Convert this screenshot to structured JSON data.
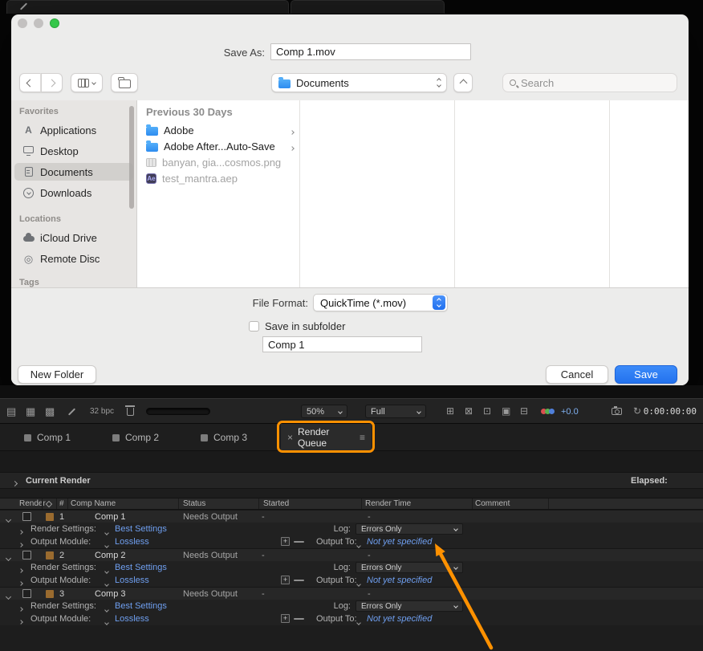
{
  "colors": {
    "accent_orange": "#ff9100",
    "link_blue": "#6f9ff0",
    "save_blue": "#2d7ff0"
  },
  "icons": {
    "applications_glyph": "A",
    "ae_badge": "Ae",
    "tab_close": "×",
    "tab_menu": "≡",
    "add": "+",
    "refresh": "↻",
    "flowchart": "▤",
    "snapshot_grid": "▦",
    "transparency_grid": "▩",
    "choose_grid": "⊞",
    "mask_toggle": "⊠",
    "region_of_interest": "⊡",
    "guides": "▣",
    "rulers": "⊟",
    "remote_disc": "◎"
  },
  "dialog": {
    "save_as_label": "Save As:",
    "filename": "Comp 1.mov",
    "toolbar": {
      "location": "Documents",
      "search_placeholder": "Search"
    },
    "sidebar": {
      "sections": [
        {
          "header": "Favorites",
          "items": [
            {
              "label": "Applications"
            },
            {
              "label": "Desktop"
            },
            {
              "label": "Documents",
              "selected": true
            },
            {
              "label": "Downloads"
            }
          ]
        },
        {
          "header": "Locations",
          "items": [
            {
              "label": "iCloud Drive"
            },
            {
              "label": "Remote Disc"
            }
          ]
        },
        {
          "header": "Tags",
          "items": []
        }
      ]
    },
    "browser": {
      "group_header": "Previous 30 Days",
      "items": [
        {
          "label": "Adobe",
          "type": "folder"
        },
        {
          "label": "Adobe After...Auto-Save",
          "type": "folder"
        },
        {
          "label": "banyan, gia...cosmos.png",
          "type": "image"
        },
        {
          "label": "test_mantra.aep",
          "type": "project"
        }
      ]
    },
    "format": {
      "label": "File Format:",
      "value": "QuickTime (*.mov)"
    },
    "subfolder": {
      "checkbox_label": "Save in subfolder",
      "field_value": "Comp 1"
    },
    "buttons": {
      "new_folder": "New Folder",
      "cancel": "Cancel",
      "save": "Save"
    }
  },
  "ae": {
    "toolbar": {
      "bit_depth": "32 bpc",
      "zoom": "50%",
      "resolution": "Full",
      "exposure": "+0.0",
      "timecode": "0:00:00:00"
    },
    "tabs": [
      {
        "label": "Comp 1"
      },
      {
        "label": "Comp 2"
      },
      {
        "label": "Comp 3"
      },
      {
        "label": "Render Queue",
        "active": true
      }
    ],
    "current_render": {
      "label": "Current Render",
      "elapsed_label": "Elapsed:"
    },
    "header": {
      "render": "Render",
      "num": "#",
      "comp_name": "Comp Name",
      "status": "Status",
      "started": "Started",
      "render_time": "Render Time",
      "comment": "Comment"
    },
    "labels": {
      "render_settings": "Render Settings:",
      "output_module": "Output Module:",
      "log": "Log:",
      "output_to": "Output To:"
    },
    "items": [
      {
        "num": "1",
        "name": "Comp 1",
        "status": "Needs Output",
        "started": "-",
        "render_time": "-",
        "render_settings": "Best Settings",
        "log": "Errors Only",
        "output_module": "Lossless",
        "output_to": "Not yet specified"
      },
      {
        "num": "2",
        "name": "Comp 2",
        "status": "Needs Output",
        "started": "-",
        "render_time": "-",
        "render_settings": "Best Settings",
        "log": "Errors Only",
        "output_module": "Lossless",
        "output_to": "Not yet specified"
      },
      {
        "num": "3",
        "name": "Comp 3",
        "status": "Needs Output",
        "started": "-",
        "render_time": "-",
        "render_settings": "Best Settings",
        "log": "Errors Only",
        "output_module": "Lossless",
        "output_to": "Not yet specified"
      }
    ]
  }
}
